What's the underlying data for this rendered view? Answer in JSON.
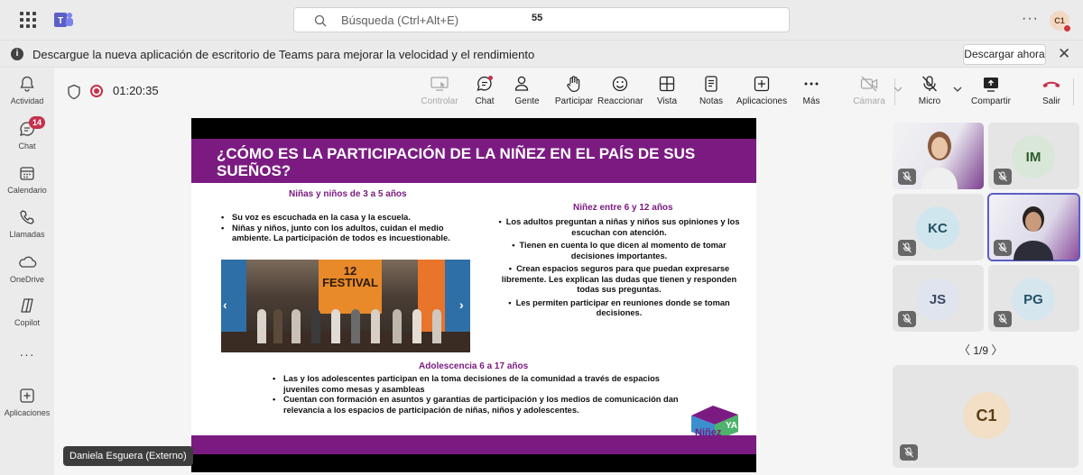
{
  "search": {
    "placeholder": "Búsqueda (Ctrl+Alt+E)"
  },
  "user": {
    "initials": "C1"
  },
  "banner": {
    "message": "Descargue la nueva aplicación de escritorio de Teams para mejorar la velocidad y el rendimiento",
    "download_label": "Descargar ahora"
  },
  "rail": {
    "items": [
      {
        "label": "Actividad"
      },
      {
        "label": "Chat",
        "badge": "14"
      },
      {
        "label": "Calendario"
      },
      {
        "label": "Llamadas"
      },
      {
        "label": "OneDrive"
      },
      {
        "label": "Copilot"
      },
      {
        "label": "Aplicaciones"
      }
    ]
  },
  "meeting": {
    "timer": "01:20:35",
    "toolbar": {
      "controlar": "Controlar",
      "chat": "Chat",
      "gente": "Gente",
      "gente_count": "55",
      "participar": "Participar",
      "reaccionar": "Reaccionar",
      "vista": "Vista",
      "notas": "Notas",
      "aplicaciones": "Aplicaciones",
      "mas": "Más",
      "camara": "Cámara",
      "micro": "Micro",
      "compartir": "Compartir",
      "salir": "Salir"
    },
    "presenter": "Daniela Esguera (Externo)",
    "pager": "1/9"
  },
  "slide": {
    "title": "¿CÓMO ES LA PARTICIPACIÓN DE LA NIÑEZ EN EL PAÍS DE SUS SUEÑOS?",
    "left_heading": "Niñas y niños de 3 a 5 años",
    "left_items": [
      "Su voz es escuchada en la casa y la escuela.",
      "Niñas y niños, junto con los adultos, cuidan el medio ambiente. La participación de todos es incuestionable."
    ],
    "right_heading": "Niñez  entre 6 y  12 años",
    "right_items": [
      "Los adultos preguntan a niñas y niños sus opiniones y los escuchan con atención.",
      "Tienen en cuenta lo que dicen al momento de tomar decisiones importantes.",
      "Crean espacios seguros para que puedan expresarse libremente. Les explican las dudas que tienen y responden todas sus preguntas.",
      "Les permiten participar en reuniones donde se toman decisiones."
    ],
    "bottom_heading": "Adolescencia 6 a 17 años",
    "bottom_items": [
      "Las y los adolescentes participan en la toma decisiones de la comunidad a través de espacios juveniles como mesas y asambleas",
      "Cuentan con formación en asuntos y garantías de participación y los medios de comunicación dan relevancia a los espacios de participación de niñas, niños y adolescentes."
    ],
    "photo_text": "12 FESTIVAL",
    "logo_text": "Niñez YA"
  },
  "participants": [
    {
      "initials": "",
      "video": true
    },
    {
      "initials": "IM",
      "bg": "#d8e7d8",
      "fg": "#2b5b2b"
    },
    {
      "initials": "KC",
      "bg": "#cfe6ee",
      "fg": "#1e4f60"
    },
    {
      "initials": "",
      "video": true,
      "selected": true
    },
    {
      "initials": "JS",
      "bg": "#dfe4ee",
      "fg": "#3a4a66"
    },
    {
      "initials": "PG",
      "bg": "#d6e6ee",
      "fg": "#24506a"
    },
    {
      "initials": "C1",
      "bg": "#f2dfc6",
      "fg": "#5b3b16"
    }
  ],
  "colors": {
    "slide_purple": "#7b1b82",
    "accent": "#5b5fc7",
    "badge": "#c4314b",
    "leave": "#c4314b"
  }
}
